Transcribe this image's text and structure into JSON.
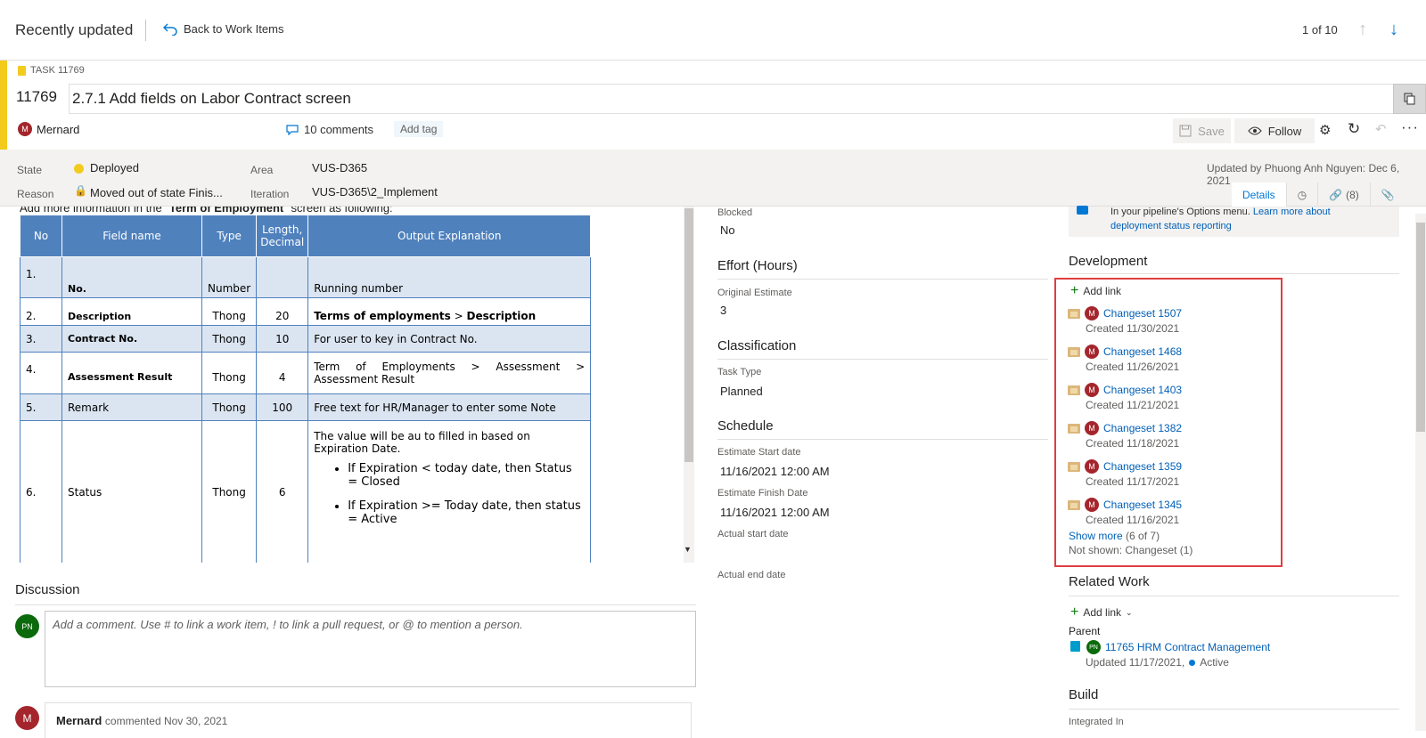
{
  "topbar": {
    "title": "Recently updated",
    "back_label": "Back to Work Items",
    "pager": "1 of 10"
  },
  "work_item": {
    "type_label": "TASK 11769",
    "id": "11769",
    "title": "2.7.1 Add fields on Labor Contract screen",
    "assignee_initial": "M",
    "assignee": "Mernard",
    "comments": "10 comments",
    "add_tag": "Add tag"
  },
  "toolbar": {
    "save": "Save",
    "follow": "Follow"
  },
  "fields": {
    "state_label": "State",
    "state": "Deployed",
    "reason_label": "Reason",
    "reason": "Moved out of state Finis...",
    "area_label": "Area",
    "area": "VUS-D365",
    "iteration_label": "Iteration",
    "iteration": "VUS-D365\\2_Implement",
    "updated_by": "Updated by Phuong Anh Nguyen: Dec 6, 2021"
  },
  "tabs": {
    "details": "Details",
    "links": "(8)"
  },
  "description": {
    "intro_prefix": "Add more information in the \"",
    "intro_bold": "Term of Employment",
    "intro_suffix": "\" screen as following:",
    "headers": [
      "No",
      "Field name",
      "Type",
      "Length, Decimal",
      "Output Explanation"
    ],
    "rows": [
      {
        "no": "1.",
        "field": "No.",
        "type": "Number",
        "length": "",
        "output": "Running number"
      },
      {
        "no": "2.",
        "field": "Description",
        "type": "Thong",
        "length": "20",
        "output_a": "Terms of employments",
        "output_sep": " > ",
        "output_b": "Description"
      },
      {
        "no": "3.",
        "field": "Contract No.",
        "type": "Thong",
        "length": "10",
        "output": "For user to key in Contract No."
      },
      {
        "no": "4.",
        "field": "Assessment Result",
        "type": "Thong",
        "length": "4",
        "output": "Term of Employments > Assessment > Assessment Result"
      },
      {
        "no": "5.",
        "field": "Remark",
        "type": "Thong",
        "length": "100",
        "output": "Free text for HR/Manager to enter some Note"
      },
      {
        "no": "6.",
        "field": "Status",
        "type": "Thong",
        "length": "6",
        "output": "The value will be au to filled in based on Expiration Date.",
        "bullet1": "If Expiration < today date, then Status = Closed",
        "bullet2": "If Expiration >= Today date, then status = Active"
      }
    ]
  },
  "discussion": {
    "title": "Discussion",
    "user_initials": "PN",
    "placeholder": "Add a comment. Use # to link a work item, ! to link a pull request, or @ to mention a person.",
    "comment_author_initial": "M",
    "comment_author": "Mernard",
    "comment_meta": "commented Nov 30, 2021"
  },
  "middle": {
    "blocked_label": "Blocked",
    "blocked": "No",
    "effort_title": "Effort (Hours)",
    "original_estimate_label": "Original Estimate",
    "original_estimate": "3",
    "classification_title": "Classification",
    "task_type_label": "Task Type",
    "task_type": "Planned",
    "schedule_title": "Schedule",
    "start_label": "Estimate Start date",
    "start": "11/16/2021 12:00 AM",
    "finish_label": "Estimate Finish Date",
    "finish": "11/16/2021 12:00 AM",
    "actual_start_label": "Actual start date",
    "actual_end_label": "Actual end date"
  },
  "right": {
    "banner_line1": "In your pipeline's Options menu.",
    "banner_link1": "Learn more about",
    "banner_link2": "deployment status reporting",
    "development_title": "Development",
    "add_link": "Add link",
    "changesets": [
      {
        "avatar": "M",
        "name": "Changeset 1507",
        "created": "Created 11/30/2021"
      },
      {
        "avatar": "M",
        "name": "Changeset 1468",
        "created": "Created 11/26/2021"
      },
      {
        "avatar": "M",
        "name": "Changeset 1403",
        "created": "Created 11/21/2021"
      },
      {
        "avatar": "M",
        "name": "Changeset 1382",
        "created": "Created 11/18/2021"
      },
      {
        "avatar": "M",
        "name": "Changeset 1359",
        "created": "Created 11/17/2021"
      },
      {
        "avatar": "M",
        "name": "Changeset 1345",
        "created": "Created 11/16/2021"
      }
    ],
    "show_more": "Show more",
    "show_more_count": "(6 of 7)",
    "not_shown": "Not shown: Changeset (1)",
    "related_title": "Related Work",
    "related_add_link": "Add link",
    "parent_label": "Parent",
    "parent_avatar": "PN",
    "parent_name": "11765 HRM Contract Management",
    "parent_updated": "Updated 11/17/2021,",
    "parent_status": "Active",
    "build_title": "Build",
    "integrated_in_label": "Integrated In"
  }
}
